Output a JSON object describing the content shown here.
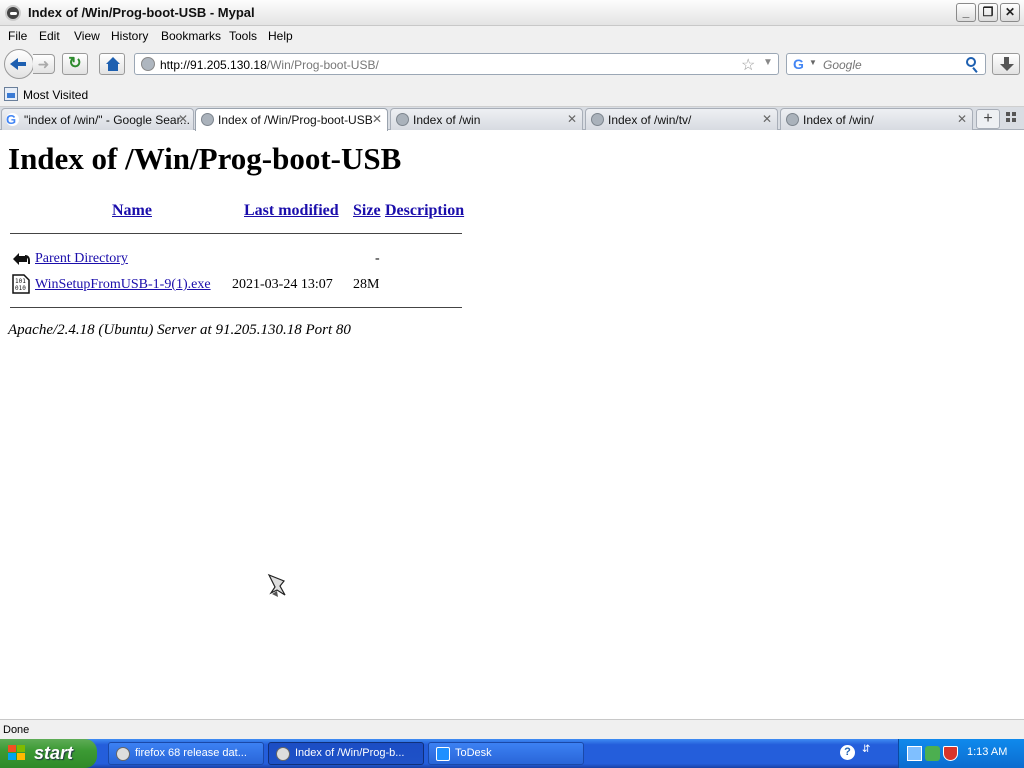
{
  "window": {
    "title": "Index of /Win/Prog-boot-USB - Mypal"
  },
  "menu": [
    "File",
    "Edit",
    "View",
    "History",
    "Bookmarks",
    "Tools",
    "Help"
  ],
  "address": {
    "host": "http://91.205.130.18",
    "path": "/Win/Prog-boot-USB/"
  },
  "search": {
    "placeholder": "Google"
  },
  "bookmarks_toolbar": {
    "most_visited": "Most Visited"
  },
  "tabs": [
    {
      "title": "\"index of /win/\" - Google Sear...",
      "favicon": "google-icon",
      "active": false
    },
    {
      "title": "Index of /Win/Prog-boot-USB",
      "favicon": "globe-icon",
      "active": true
    },
    {
      "title": "Index of /win",
      "favicon": "globe-icon",
      "active": false
    },
    {
      "title": "Index of /win/tv/",
      "favicon": "globe-icon",
      "active": false
    },
    {
      "title": "Index of /win/",
      "favicon": "globe-icon",
      "active": false
    }
  ],
  "page": {
    "heading": "Index of /Win/Prog-boot-USB",
    "columns": {
      "name": "Name",
      "last_modified": "Last modified",
      "size": "Size",
      "description": "Description"
    },
    "rows": [
      {
        "name": "Parent Directory",
        "modified": "",
        "size": "-",
        "icon": "back-arrow-icon"
      },
      {
        "name": "WinSetupFromUSB-1-9(1).exe",
        "modified": "2021-03-24 13:07",
        "size": "28M",
        "icon": "binary-file-icon"
      }
    ],
    "server_signature": "Apache/2.4.18 (Ubuntu) Server at 91.205.130.18 Port 80"
  },
  "status": {
    "text": "Done"
  },
  "taskbar": {
    "start_label": "start",
    "tasks": [
      {
        "label": "firefox 68 release dat...",
        "active": false
      },
      {
        "label": "Index of /Win/Prog-b...",
        "active": true
      },
      {
        "label": "ToDesk",
        "active": false
      }
    ],
    "clock": "1:13 AM"
  }
}
